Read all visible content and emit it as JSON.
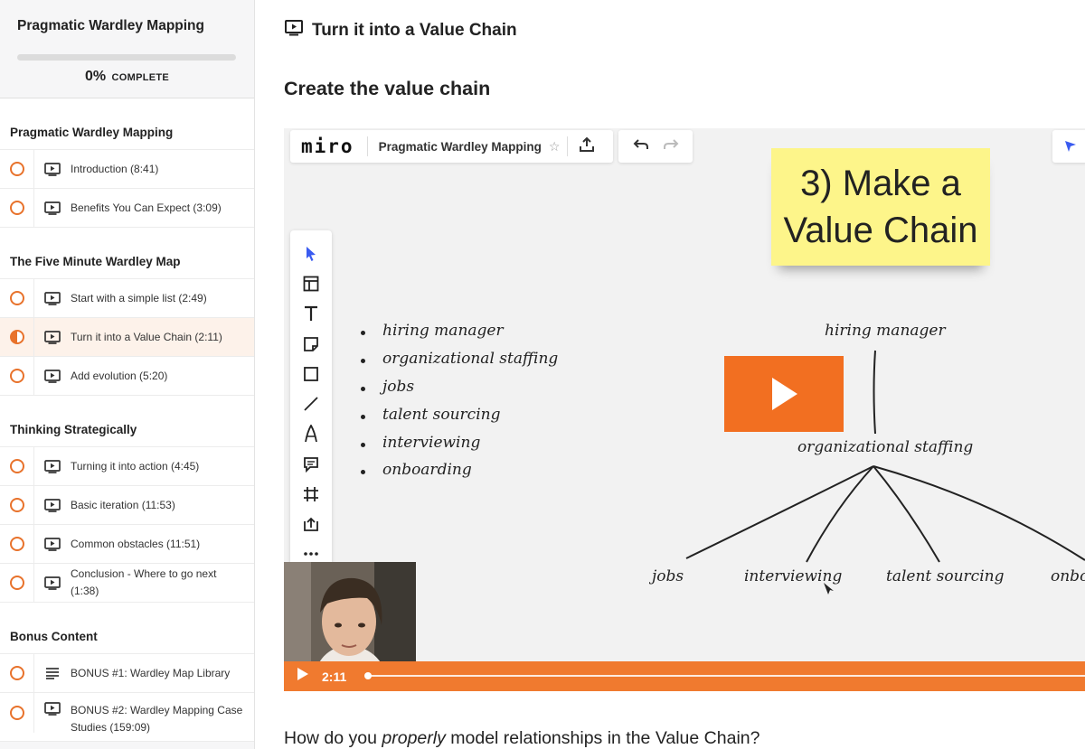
{
  "course": {
    "title": "Pragmatic Wardley Mapping",
    "progress_percent": 0,
    "progress_pct_label": "0%",
    "progress_word": "COMPLETE"
  },
  "sections": [
    {
      "title": "Pragmatic Wardley Mapping",
      "lectures": [
        {
          "title": "Introduction (8:41)",
          "status": "not-started",
          "icon": "video-icon"
        },
        {
          "title": "Benefits You Can Expect (3:09)",
          "status": "not-started",
          "icon": "video-icon"
        }
      ]
    },
    {
      "title": "The Five Minute Wardley Map",
      "lectures": [
        {
          "title": "Start with a simple list (2:49)",
          "status": "not-started",
          "icon": "video-icon"
        },
        {
          "title": "Turn it into a Value Chain (2:11)",
          "status": "in-progress",
          "icon": "video-icon"
        },
        {
          "title": "Add evolution (5:20)",
          "status": "not-started",
          "icon": "video-icon"
        }
      ]
    },
    {
      "title": "Thinking Strategically",
      "lectures": [
        {
          "title": "Turning it into action (4:45)",
          "status": "not-started",
          "icon": "video-icon"
        },
        {
          "title": "Basic iteration (11:53)",
          "status": "not-started",
          "icon": "video-icon"
        },
        {
          "title": "Common obstacles (11:51)",
          "status": "not-started",
          "icon": "video-icon"
        },
        {
          "title": "Conclusion - Where to go next (1:38)",
          "status": "not-started",
          "icon": "video-icon"
        }
      ]
    },
    {
      "title": "Bonus Content",
      "lectures": [
        {
          "title": "BONUS #1: Wardley Map Library",
          "status": "not-started",
          "icon": "text-icon"
        },
        {
          "title": "BONUS #2: Wardley Mapping Case Studies (159:09)",
          "status": "not-started",
          "icon": "video-icon"
        }
      ]
    }
  ],
  "lecture": {
    "title": "Turn it into a Value Chain",
    "section_heading": "Create the value chain",
    "question_pre": "How do you ",
    "question_em": "properly",
    "question_post": " model relationships in the Value Chain?"
  },
  "video": {
    "miro_logo": "miro",
    "board_name": "Pragmatic Wardley Mapping",
    "sticky_line1": "3) Make a",
    "sticky_line2": "Value Chain",
    "list_items": [
      "hiring manager",
      "organizational staffing",
      "jobs",
      "talent sourcing",
      "interviewing",
      "onboarding"
    ],
    "chain_top": "hiring manager",
    "chain_mid": "organizational staffing",
    "chain_leaves": [
      "jobs",
      "interviewing",
      "talent sourcing",
      "onbo"
    ],
    "time": "2:11",
    "played_fraction": 0,
    "accent_color": "#f26f21"
  }
}
